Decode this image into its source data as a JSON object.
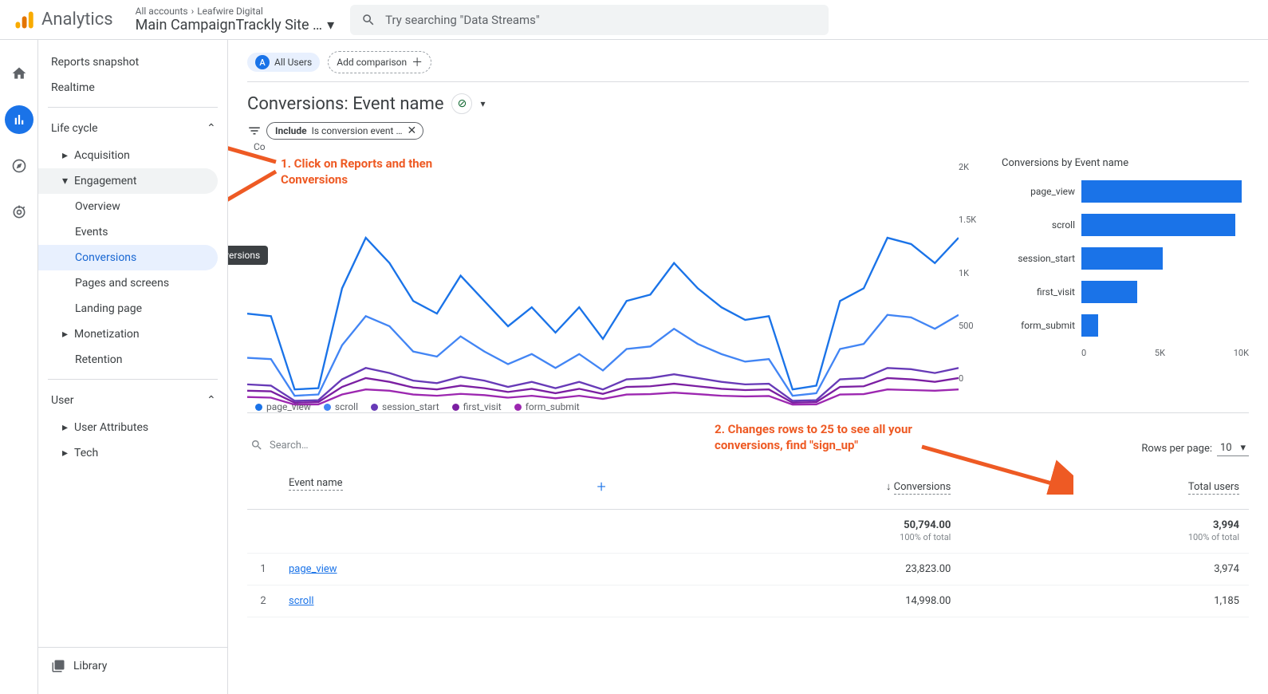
{
  "header": {
    "logo_text": "Analytics",
    "breadcrumb_all": "All accounts",
    "breadcrumb_account": "Leafwire Digital",
    "property": "Main CampaignTrackly Site …",
    "search_placeholder": "Try searching \"Data Streams\""
  },
  "sidebar": {
    "snapshot": "Reports snapshot",
    "realtime": "Realtime",
    "section_lifecycle": "Life cycle",
    "acquisition": "Acquisition",
    "engagement": "Engagement",
    "eng_overview": "Overview",
    "eng_events": "Events",
    "eng_conversions": "Conversions",
    "eng_pages": "Pages and screens",
    "eng_landing": "Landing page",
    "monetization": "Monetization",
    "retention": "Retention",
    "section_user": "User",
    "user_attributes": "User Attributes",
    "tech": "Tech",
    "library": "Library"
  },
  "page": {
    "all_users": "All Users",
    "all_badge": "A",
    "add_comparison": "Add comparison",
    "title": "Conversions: Event name",
    "filter_label": "Include",
    "filter_value": "Is conversion event …",
    "tooltip": "Conversions",
    "chart_label": "Co"
  },
  "chart_data": {
    "line": {
      "type": "line",
      "ylim": [
        0,
        2000
      ],
      "y_ticks": [
        "2K",
        "1.5K",
        "1K",
        "500",
        "0"
      ],
      "series": [
        {
          "name": "page_view",
          "color": "#1a73e8",
          "values": [
            800,
            780,
            200,
            210,
            1000,
            1400,
            1200,
            900,
            800,
            1100,
            900,
            700,
            850,
            650,
            850,
            600,
            900,
            950,
            1200,
            1000,
            850,
            750,
            780,
            200,
            230,
            900,
            1000,
            1400,
            1350,
            1200,
            1400
          ]
        },
        {
          "name": "scroll",
          "color": "#4285f4",
          "values": [
            450,
            440,
            150,
            160,
            550,
            780,
            700,
            500,
            460,
            620,
            500,
            400,
            480,
            370,
            480,
            350,
            520,
            540,
            680,
            560,
            480,
            420,
            440,
            150,
            170,
            520,
            560,
            790,
            770,
            680,
            790
          ]
        },
        {
          "name": "session_start",
          "color": "#673ab7",
          "values": [
            240,
            230,
            110,
            115,
            280,
            370,
            330,
            270,
            250,
            300,
            270,
            220,
            260,
            210,
            260,
            200,
            280,
            290,
            320,
            290,
            260,
            240,
            245,
            110,
            115,
            280,
            290,
            370,
            360,
            330,
            370
          ]
        },
        {
          "name": "first_visit",
          "color": "#7b1fa2",
          "values": [
            190,
            185,
            95,
            100,
            220,
            290,
            260,
            215,
            200,
            230,
            210,
            180,
            205,
            170,
            205,
            165,
            220,
            225,
            245,
            225,
            205,
            195,
            200,
            95,
            100,
            220,
            225,
            290,
            280,
            260,
            290
          ]
        },
        {
          "name": "form_submit",
          "color": "#9c27b0",
          "values": [
            140,
            135,
            80,
            82,
            160,
            200,
            190,
            160,
            150,
            165,
            155,
            135,
            150,
            130,
            150,
            125,
            160,
            163,
            175,
            163,
            150,
            145,
            148,
            80,
            82,
            160,
            163,
            200,
            195,
            190,
            200
          ]
        }
      ]
    },
    "bar": {
      "type": "bar",
      "title": "Conversions by Event name",
      "categories": [
        "page_view",
        "scroll",
        "session_start",
        "first_visit",
        "form_submit"
      ],
      "values": [
        11500,
        11000,
        5800,
        4000,
        1200
      ],
      "xlim": [
        0,
        12000
      ],
      "x_ticks": [
        "0",
        "5K",
        "10K"
      ]
    }
  },
  "table": {
    "search_placeholder": "Search…",
    "rows_per_label": "Rows per page:",
    "rows_per_value": "10",
    "col_event": "Event name",
    "col_conversions": "Conversions",
    "col_users": "Total users",
    "total_conversions": "50,794.00",
    "total_users": "3,994",
    "total_pct": "100% of total",
    "rows": [
      {
        "idx": "1",
        "event": "page_view",
        "conversions": "23,823.00",
        "users": "3,974"
      },
      {
        "idx": "2",
        "event": "scroll",
        "conversions": "14,998.00",
        "users": "1,185"
      }
    ]
  },
  "annotations": {
    "callout1": "1. Click on Reports and then Conversions",
    "callout2": "2. Changes rows to 25 to see all your conversions, find \"sign_up\""
  }
}
